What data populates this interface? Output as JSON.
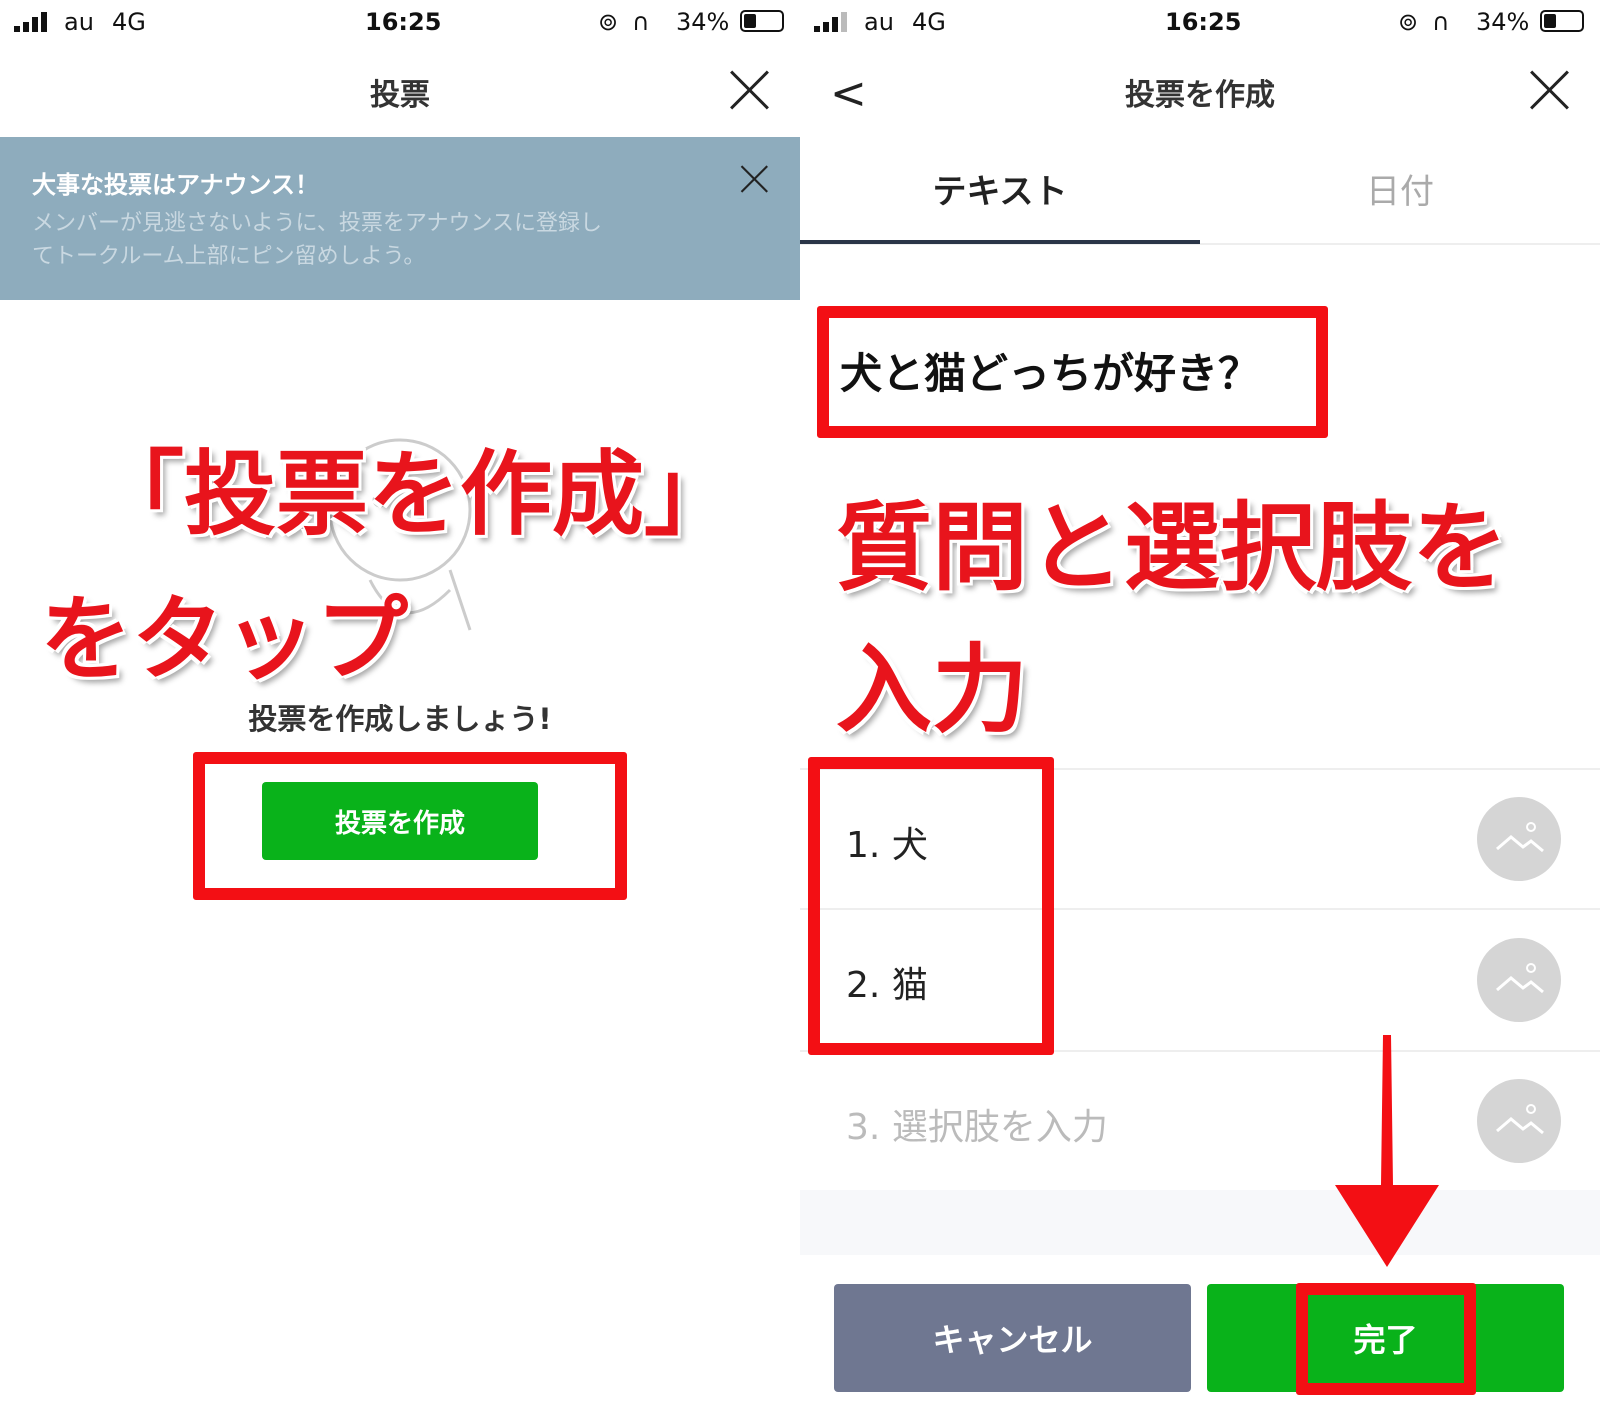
{
  "status_bar": {
    "carrier": "au",
    "network": "4G",
    "time": "16:25",
    "battery": "34%"
  },
  "left": {
    "header": {
      "title": "投票"
    },
    "banner": {
      "title": "大事な投票はアナウンス！",
      "body_line1": "メンバーが見逃さないように、投票をアナウンスに登録し",
      "body_line2": "てトークルーム上部にピン留めしよう。"
    },
    "annotation_line1": "「投票を作成」",
    "annotation_line2": "をタップ",
    "empty_message": "投票を作成しましょう!",
    "create_button": "投票を作成"
  },
  "right": {
    "header": {
      "title": "投票を作成"
    },
    "tabs": [
      {
        "label": "テキスト",
        "active": true
      },
      {
        "label": "日付",
        "active": false
      }
    ],
    "question": "犬と猫どっちが好き？",
    "annotation_line1": "質問と選択肢を",
    "annotation_line2": "入力",
    "options": [
      {
        "number": "1.",
        "text": "犬"
      },
      {
        "number": "2.",
        "text": "猫"
      },
      {
        "number": "3.",
        "placeholder": "選択肢を入力"
      }
    ],
    "cancel_button": "キャンセル",
    "done_button": "完了"
  },
  "colors": {
    "accent_green": "#09b21a",
    "annotation_red": "#f30f14",
    "banner_bg": "#8eacbd",
    "cancel_bg": "#6f7791"
  }
}
